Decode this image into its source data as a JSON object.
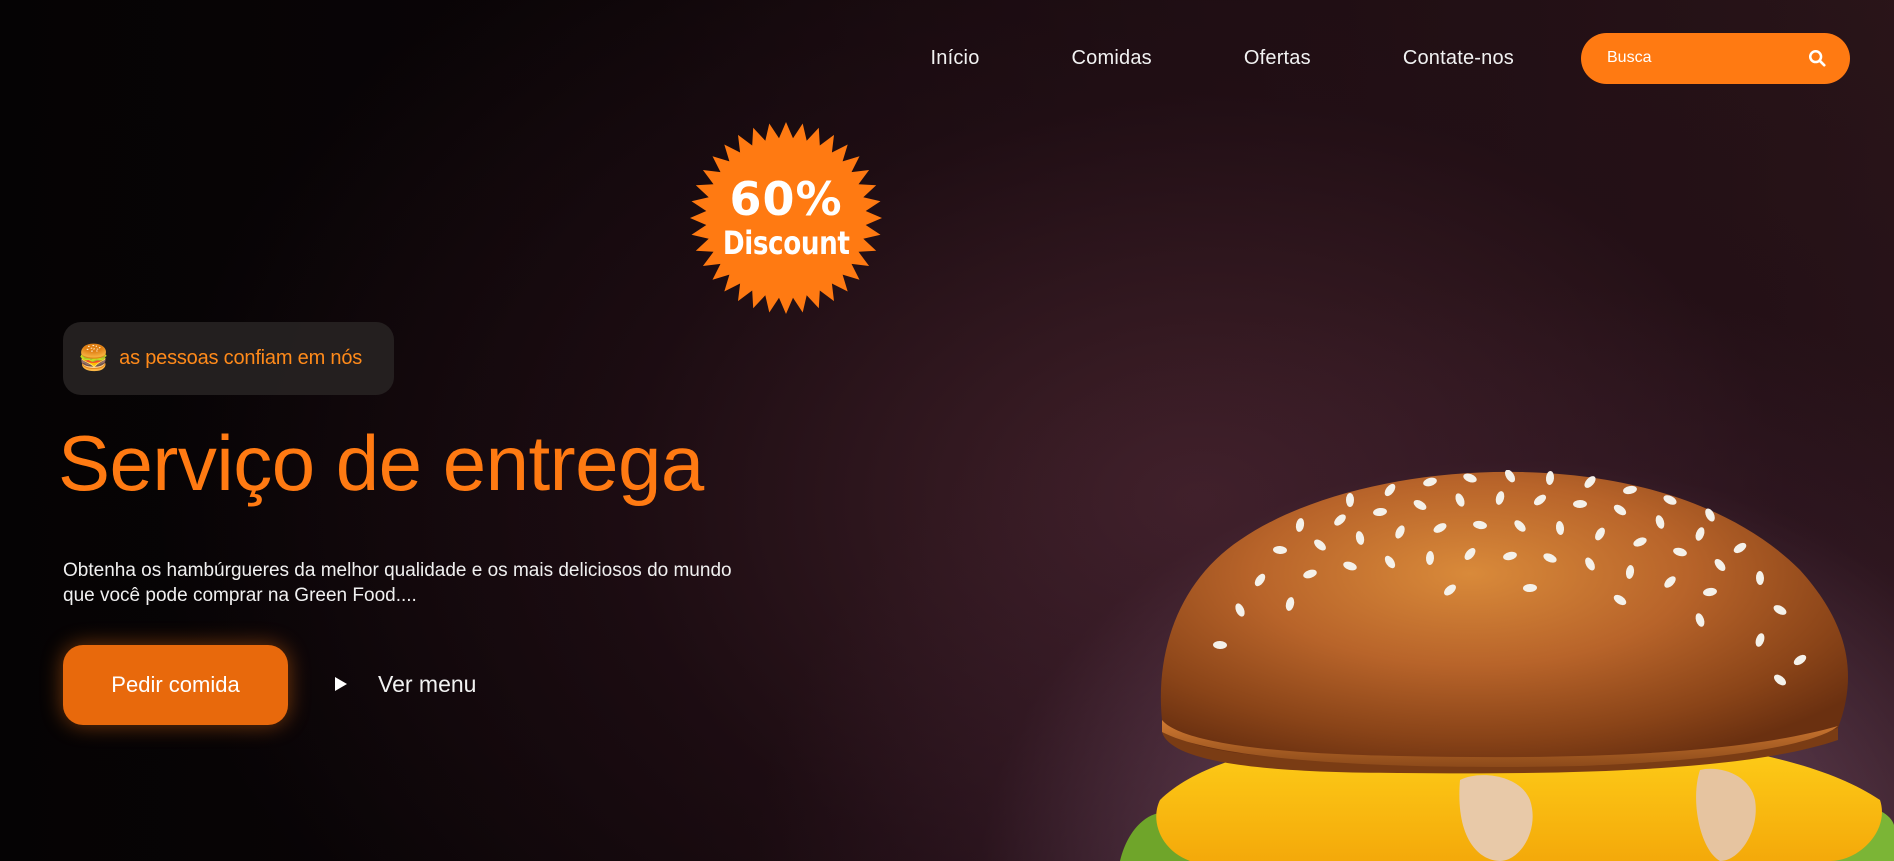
{
  "nav": {
    "links": [
      "Início",
      "Comidas",
      "Ofertas",
      "Contate-nos"
    ],
    "search_placeholder": "Busca"
  },
  "badge": {
    "percent": "60%",
    "word": "Discount"
  },
  "trust": {
    "emoji": "🍔",
    "text": "as pessoas confiam em nós"
  },
  "hero": {
    "title": "Serviço de entrega",
    "description_line1": "Obtenha os hambúrgueres da melhor qualidade e os mais deliciosos do mundo",
    "description_line2": "que você pode comprar na Green Food....",
    "order_button": "Pedir comida",
    "menu_button": "Ver menu"
  },
  "colors": {
    "accent": "#ff7a12",
    "button": "#e8690c",
    "background": "#0b0507"
  },
  "icons": [
    "search-icon",
    "play-icon",
    "burger-image"
  ]
}
